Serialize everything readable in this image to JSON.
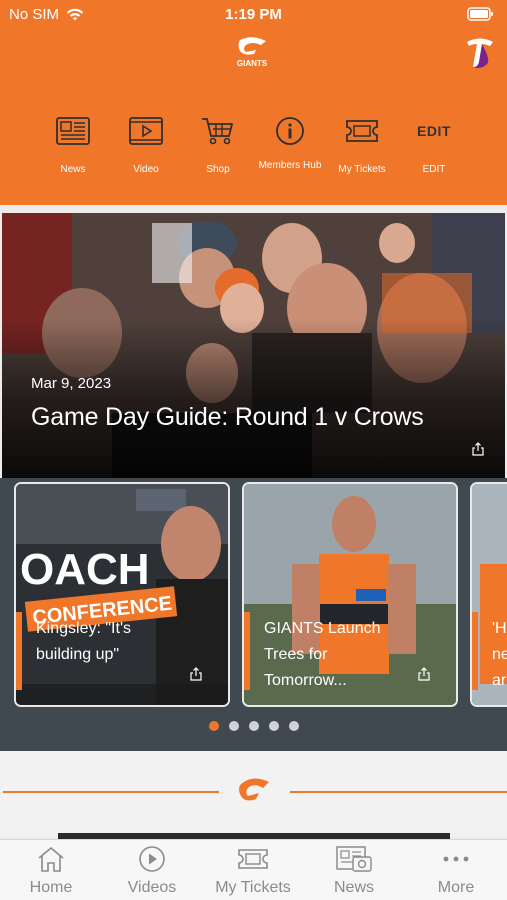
{
  "status_bar": {
    "carrier": "No SIM",
    "time": "1:19 PM"
  },
  "brand": {
    "logo_text": "GIANTS",
    "accent": "#f0772a",
    "sponsor_icon": "telstra-logo"
  },
  "quick_nav": [
    {
      "label": "News",
      "icon": "newspaper-icon"
    },
    {
      "label": "Video",
      "icon": "video-icon"
    },
    {
      "label": "Shop",
      "icon": "shopping-cart-icon"
    },
    {
      "label": "Members Hub",
      "icon": "info-icon"
    },
    {
      "label": "My Tickets",
      "icon": "ticket-icon"
    },
    {
      "label": "EDIT",
      "icon_text": "EDIT"
    }
  ],
  "hero": {
    "date": "Mar 9, 2023",
    "title": "Game Day Guide: Round 1 v Crows"
  },
  "carousel": {
    "cards": [
      {
        "title": "Kingsley: \"It's building up\"",
        "overlay_words": [
          "OACH",
          "CONFERENCE"
        ]
      },
      {
        "title": "GIANTS Launch Trees for Tomorrow..."
      },
      {
        "title": "'H ne ar"
      }
    ],
    "dots_count": 5,
    "active_dot": 1
  },
  "tab_bar": [
    {
      "label": "Home",
      "icon": "home-icon"
    },
    {
      "label": "Videos",
      "icon": "play-circle-icon"
    },
    {
      "label": "My Tickets",
      "icon": "ticket-icon"
    },
    {
      "label": "News",
      "icon": "news-icon"
    },
    {
      "label": "More",
      "icon": "more-icon"
    }
  ]
}
